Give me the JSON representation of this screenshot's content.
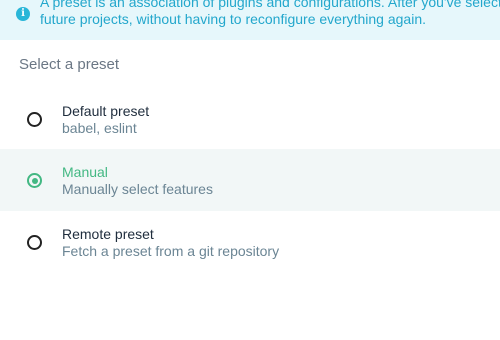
{
  "banner": {
    "icon": "info-icon",
    "line1": "A preset is an association of plugins and configurations. After you've selected",
    "line2": "future projects, without having to reconfigure everything again."
  },
  "section_title": "Select a preset",
  "presets": [
    {
      "title": "Default preset",
      "description": "babel, eslint",
      "selected": false
    },
    {
      "title": "Manual",
      "description": "Manually select features",
      "selected": true
    },
    {
      "title": "Remote preset",
      "description": "Fetch a preset from a git repository",
      "selected": false
    }
  ],
  "colors": {
    "accent": "#43b883",
    "info": "#29b6d8",
    "banner_bg": "#e6f7fb",
    "selected_bg": "#f2f7f7"
  }
}
